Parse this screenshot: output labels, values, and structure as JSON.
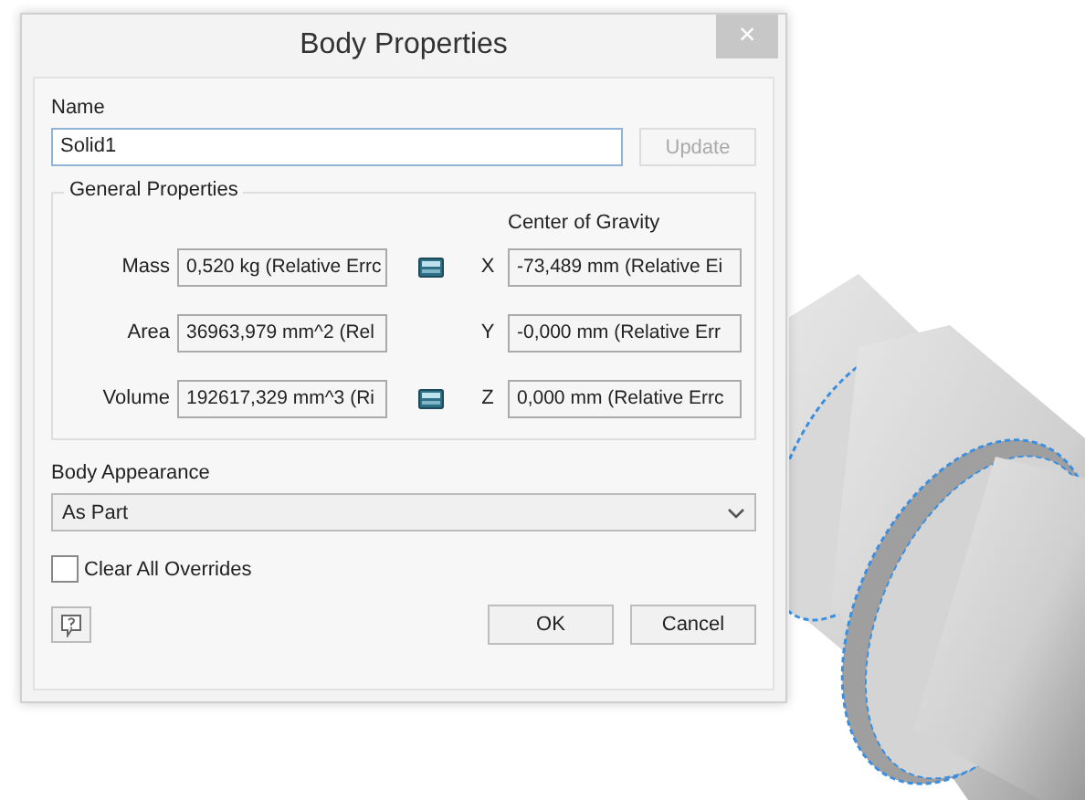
{
  "window": {
    "title": "Body Properties",
    "close": "×"
  },
  "name": {
    "label": "Name",
    "value": "Solid1",
    "update_button": {
      "label": "Update",
      "disabled": true
    }
  },
  "general_properties": {
    "title": "General Properties",
    "cog_heading": "Center of Gravity",
    "rows": [
      {
        "label": "Mass",
        "value": "0,520 kg (Relative Errc",
        "calculator": true,
        "axis": "X",
        "cog_value": "-73,489 mm (Relative Ei"
      },
      {
        "label": "Area",
        "value": "36963,979 mm^2 (Rel",
        "calculator": false,
        "axis": "Y",
        "cog_value": "-0,000 mm (Relative Err"
      },
      {
        "label": "Volume",
        "value": "192617,329 mm^3 (Ri",
        "calculator": true,
        "axis": "Z",
        "cog_value": "0,000 mm (Relative Errc"
      }
    ]
  },
  "body_appearance": {
    "label": "Body Appearance",
    "value": "As Part"
  },
  "clear_overrides": {
    "label": "Clear All Overrides",
    "checked": false
  },
  "buttons": [
    {
      "label": "OK"
    },
    {
      "label": "Cancel"
    }
  ]
}
